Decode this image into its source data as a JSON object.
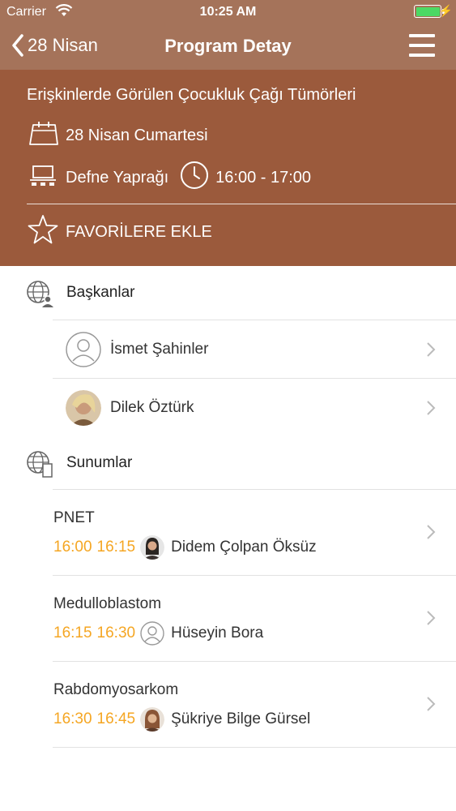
{
  "status_bar": {
    "carrier": "Carrier",
    "time": "10:25 AM",
    "charging_symbol": "⚡"
  },
  "nav": {
    "back_label": "28 Nisan",
    "title": "Program Detay"
  },
  "session": {
    "title": "Erişkinlerde Görülen Çocukluk Çağı Tümörleri",
    "date": "28 Nisan Cumartesi",
    "venue": "Defne Yaprağı",
    "time": "16:00 - 17:00",
    "favorite_label": "FAVORİLERE EKLE"
  },
  "chairs": {
    "header": "Başkanlar",
    "items": [
      {
        "name": "İsmet Şahinler",
        "avatar": "placeholder"
      },
      {
        "name": "Dilek Öztürk",
        "avatar": "photo"
      }
    ]
  },
  "presentations": {
    "header": "Sunumlar",
    "items": [
      {
        "title": "PNET",
        "start": "16:00",
        "end": "16:15",
        "speaker": "Didem Çolpan Öksüz",
        "avatar": "photo"
      },
      {
        "title": "Medulloblastom",
        "start": "16:15",
        "end": "16:30",
        "speaker": "Hüseyin Bora",
        "avatar": "placeholder"
      },
      {
        "title": "Rabdomyosarkom",
        "start": "16:30",
        "end": "16:45",
        "speaker": "Şükriye Bilge Gürsel",
        "avatar": "photo"
      }
    ]
  },
  "colors": {
    "nav_bg": "#a5735a",
    "info_bg": "#9b5a3c",
    "time_accent": "#f5a623"
  }
}
